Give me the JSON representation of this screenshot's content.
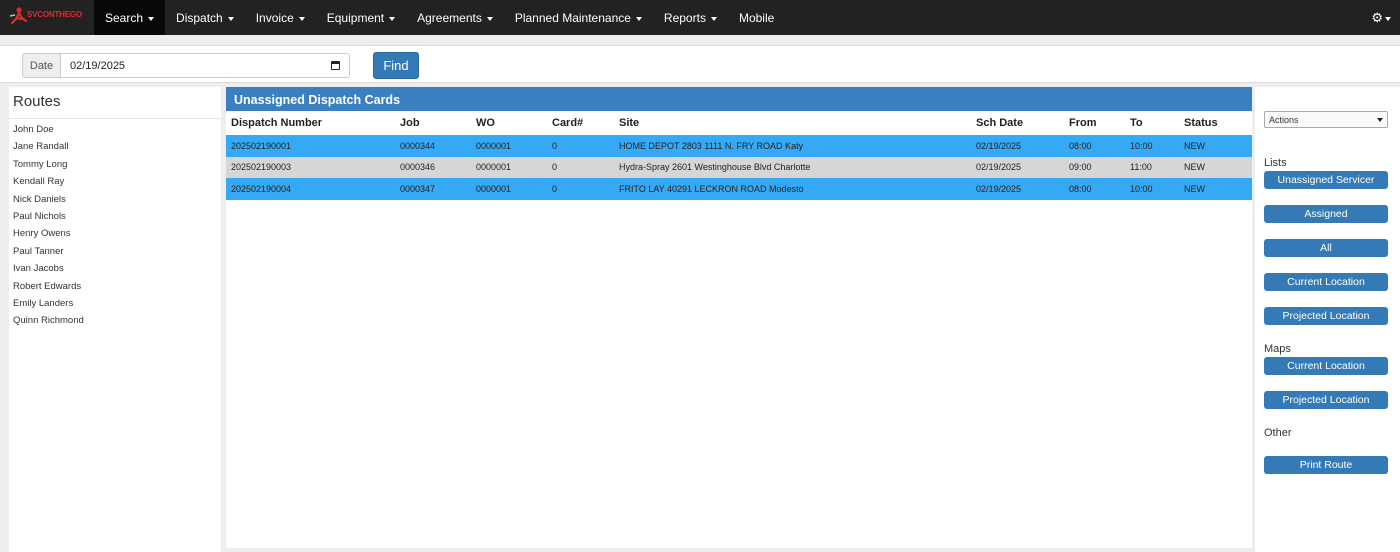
{
  "brand": {
    "name": "SVCONTHEGO"
  },
  "nav": {
    "items": [
      {
        "label": "Search",
        "dropdown": true,
        "active": true
      },
      {
        "label": "Dispatch",
        "dropdown": true
      },
      {
        "label": "Invoice",
        "dropdown": true
      },
      {
        "label": "Equipment",
        "dropdown": true
      },
      {
        "label": "Agreements",
        "dropdown": true
      },
      {
        "label": "Planned Maintenance",
        "dropdown": true
      },
      {
        "label": "Reports",
        "dropdown": true
      },
      {
        "label": "Mobile",
        "dropdown": false
      }
    ],
    "settings_icon": "gear-icon"
  },
  "filter": {
    "date_label": "Date",
    "date_value": "02/19/2025",
    "find_label": "Find"
  },
  "routes": {
    "title": "Routes",
    "items": [
      "John Doe",
      "Jane Randall",
      "Tommy Long",
      "Kendall Ray",
      "Nick Daniels",
      "Paul Nichols",
      "Henry Owens",
      "Paul Tanner",
      "Ivan Jacobs",
      "Robert Edwards",
      "Emily Landers",
      "Quinn Richmond"
    ]
  },
  "dispatch": {
    "title": "Unassigned Dispatch Cards",
    "columns": {
      "dispatch_number": "Dispatch Number",
      "job": "Job",
      "wo": "WO",
      "card": "Card#",
      "site": "Site",
      "sch_date": "Sch Date",
      "from": "From",
      "to": "To",
      "status": "Status"
    },
    "rows": [
      {
        "dispatch_number": "202502190001",
        "job": "0000344",
        "wo": "0000001",
        "card": "0",
        "site": "HOME DEPOT 2803 1111 N. FRY ROAD Katy",
        "sch_date": "02/19/2025",
        "from": "08:00",
        "to": "10:00",
        "status": "NEW",
        "highlight": "#35a9f5"
      },
      {
        "dispatch_number": "202502190003",
        "job": "0000346",
        "wo": "0000001",
        "card": "0",
        "site": "Hydra-Spray 2601 Westinghouse Blvd Charlotte",
        "sch_date": "02/19/2025",
        "from": "09:00",
        "to": "11:00",
        "status": "NEW",
        "highlight": "#d6d6d6"
      },
      {
        "dispatch_number": "202502190004",
        "job": "0000347",
        "wo": "0000001",
        "card": "0",
        "site": "FRITO LAY 40291 LECKRON ROAD Modesto",
        "sch_date": "02/19/2025",
        "from": "08:00",
        "to": "10:00",
        "status": "NEW",
        "highlight": "#35a9f5"
      }
    ]
  },
  "sidebar": {
    "actions_label": "Actions",
    "lists_label": "Lists",
    "lists": [
      "Unassigned Servicer",
      "Assigned",
      "All",
      "Current Location",
      "Projected Location"
    ],
    "maps_label": "Maps",
    "maps": [
      "Current Location",
      "Projected Location"
    ],
    "other_label": "Other",
    "other": [
      "Print Route"
    ]
  },
  "colors": {
    "navbar": "#222222",
    "primary": "#337ab7",
    "panel_header": "#3a7fc0",
    "row_highlight": "#35a9f5",
    "row_alt": "#d6d6d6",
    "brand": "#e02a2a"
  }
}
